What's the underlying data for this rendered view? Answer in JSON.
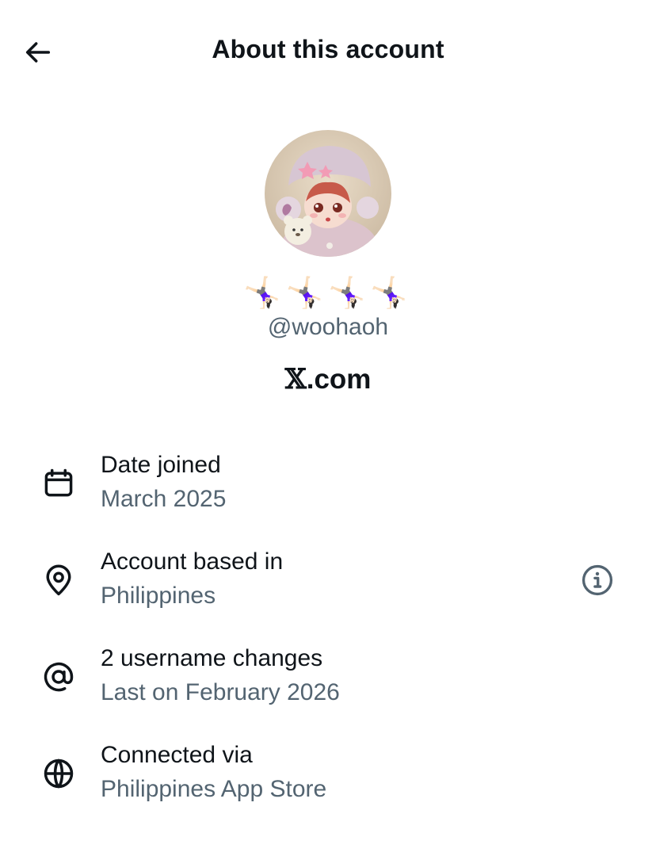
{
  "header": {
    "title": "About this account",
    "back_icon": "arrow-left-icon"
  },
  "profile": {
    "avatar_icon": "doll-avatar",
    "display_name": "🤸🏻‍♀️🤸🏻‍♀️🤸🏻‍♀️🤸🏻‍♀️",
    "handle": "@woohaoh",
    "verified_via_x": "𝕏",
    "verified_via_rest": ".com"
  },
  "rows": [
    {
      "icon": "calendar-icon",
      "title": "Date joined",
      "subtitle": "March 2025"
    },
    {
      "icon": "location-pin-icon",
      "title": "Account based in",
      "subtitle": "Philippines",
      "action_icon": "info-icon"
    },
    {
      "icon": "at-sign-icon",
      "title": "2 username changes",
      "subtitle": "Last on February 2026"
    },
    {
      "icon": "globe-icon",
      "title": "Connected via",
      "subtitle": "Philippines App Store"
    }
  ],
  "colors": {
    "primary_text": "#0f1419",
    "secondary_text": "#536471",
    "background": "#ffffff"
  }
}
